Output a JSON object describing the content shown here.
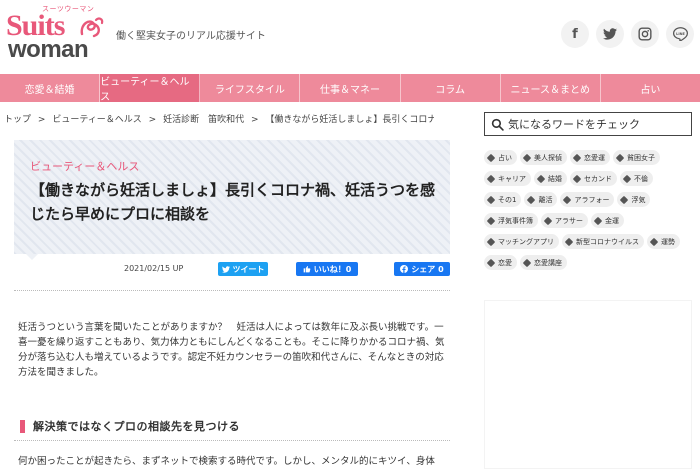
{
  "header": {
    "logo_kana": "スーツウーマン",
    "logo_top": "Suits",
    "logo_bottom": "woman",
    "tagline": "働く堅実女子のリアル応援サイト",
    "social": [
      {
        "icon": "facebook-icon",
        "glyph": "f"
      },
      {
        "icon": "twitter-icon",
        "glyph": "t"
      },
      {
        "icon": "instagram-icon",
        "glyph": "◎"
      },
      {
        "icon": "line-icon",
        "glyph": "L"
      }
    ]
  },
  "nav": {
    "items": [
      "恋愛＆結婚",
      "ビューティー＆ヘルス",
      "ライフスタイル",
      "仕事＆マネー",
      "コラム",
      "ニュース＆まとめ",
      "占い"
    ],
    "active_index": 1
  },
  "breadcrumb": [
    "トップ",
    ">",
    "ビューティー＆ヘルス",
    ">",
    "妊活診断　笛吹和代",
    ">",
    "【働きながら妊活しましょ】長引くコロナ禍, 妊活うつ..."
  ],
  "article": {
    "category": "ビューティー＆ヘルス",
    "title": "【働きながら妊活しましょ】長引くコロナ禍、妊活うつを感じたら早めにプロに相談を",
    "date": "2021/02/15 UP",
    "tweet_label": "ツイート",
    "like_label": "いいね！0",
    "share_label": "シェア 0",
    "lead": "妊活うつという言葉を聞いたことがありますか？　妊活は人によっては数年に及ぶ長い挑戦です。一喜一憂を繰り返すこともあり、気力体力ともにしんどくなることも。そこに降りかかるコロナ禍、気分が落ち込む人も増えているようです。認定不妊カウンセラーの笛吹和代さんに、そんなときの対応方法を聞きました。",
    "heading": "解決策ではなくプロの相談先を見つける",
    "body": "何か困ったことが起きたら、まずネットで検索する時代です。しかし、メンタル的にキツイ、身体"
  },
  "sidebar": {
    "search_placeholder": "気になるワードをチェック",
    "tags": [
      "占い",
      "美人探偵",
      "恋愛運",
      "貧困女子",
      "キャリア",
      "結婚",
      "セカンド",
      "不倫",
      "その1",
      "離活",
      "アラフォー",
      "浮気",
      "浮気事件簿",
      "アラサー",
      "金運",
      "マッチングアプリ",
      "新型コロナウイルス",
      "運勢",
      "恋愛",
      "恋愛講座"
    ]
  },
  "colors": {
    "brand_pink": "#e8587a",
    "nav_pink": "#ee8a9b",
    "twitter_blue": "#1da1f2",
    "facebook_blue": "#1877f2"
  }
}
